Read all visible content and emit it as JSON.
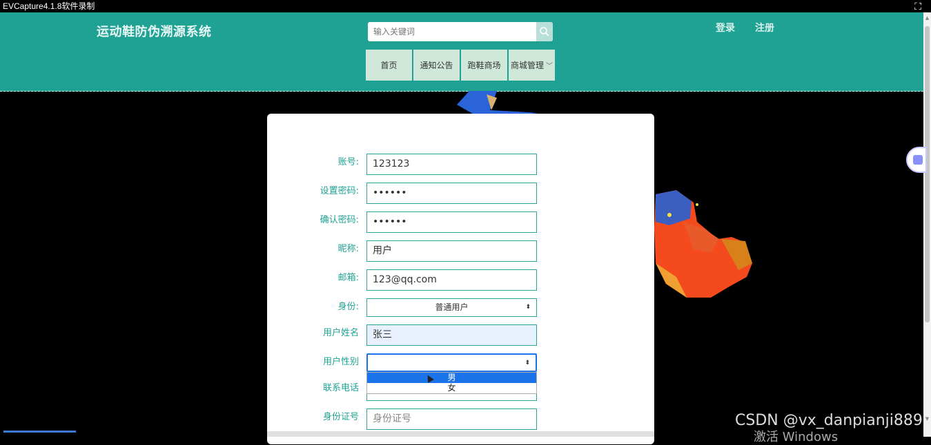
{
  "titlebar": {
    "title": "EVCapture4.1.8软件录制"
  },
  "header": {
    "site_title": "运动鞋防伪溯源系统",
    "search_placeholder": "输入关键词",
    "login": "登录",
    "register": "注册",
    "nav": [
      {
        "label": "首页"
      },
      {
        "label": "通知公告"
      },
      {
        "label": "跑鞋商场"
      },
      {
        "label": "商城管理"
      }
    ]
  },
  "form": {
    "fields": [
      {
        "label": "账号:",
        "value": "123123"
      },
      {
        "label": "设置密码:",
        "value": "••••••"
      },
      {
        "label": "确认密码:",
        "value": "••••••"
      },
      {
        "label": "昵称:",
        "value": "用户"
      },
      {
        "label": "邮箱:",
        "value": "123@qq.com"
      },
      {
        "label": "身份:",
        "value": "普通用户"
      },
      {
        "label": "用户姓名",
        "value": "张三"
      },
      {
        "label": "用户性别",
        "value": ""
      },
      {
        "label": "联系电话",
        "value": ""
      },
      {
        "label": "身份证号",
        "placeholder": "身份证号"
      }
    ],
    "gender_options": [
      "男",
      "女"
    ]
  },
  "watermark": {
    "csdn": "CSDN @vx_danpianji889",
    "windows": "激活 Windows"
  },
  "colors": {
    "header_bg": "#1fa294",
    "nav_bg": "#cfe8da",
    "accent": "#2aa596",
    "select_blue": "#1a73e8"
  }
}
